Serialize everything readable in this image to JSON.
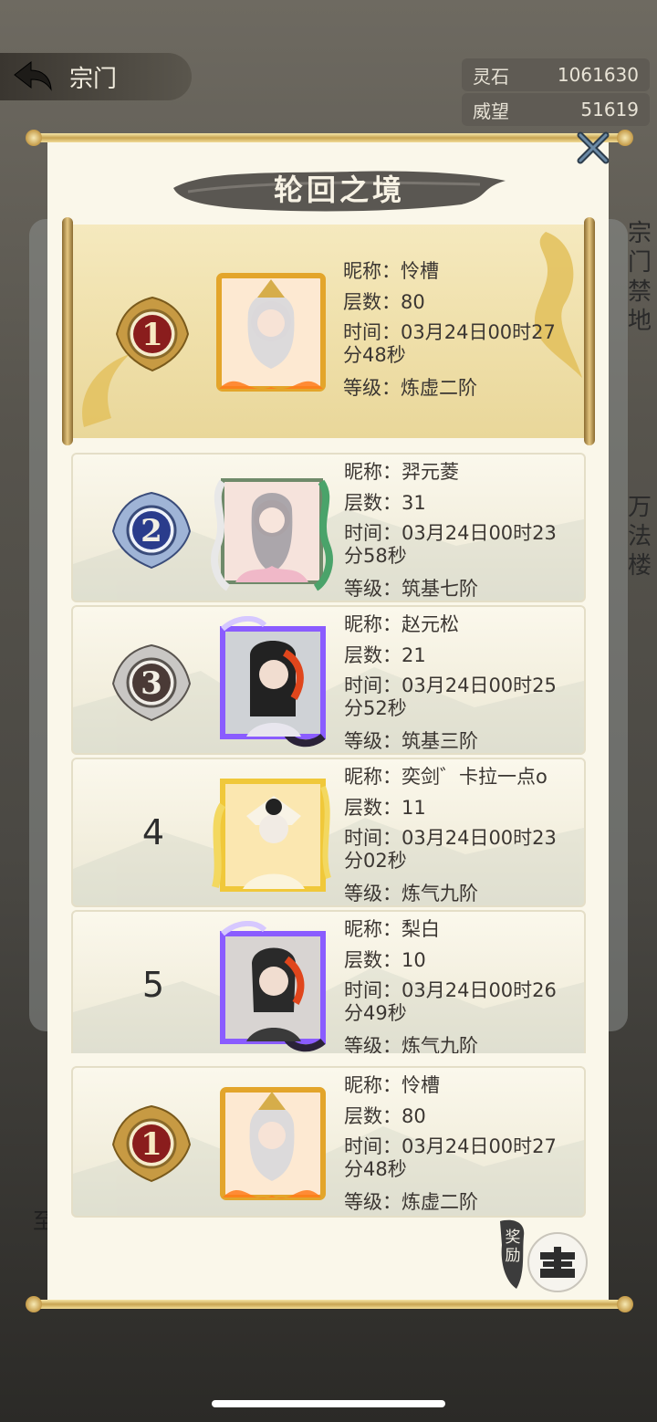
{
  "header": {
    "back_label": "宗门",
    "resources": [
      {
        "name": "灵石",
        "value": "1061630"
      },
      {
        "name": "威望",
        "value": "51619"
      }
    ]
  },
  "background": {
    "side_labels": [
      "宗门禁地",
      "万法楼"
    ],
    "left_label": "至"
  },
  "modal": {
    "title": "轮回之境",
    "labels": {
      "nickname": "昵称：",
      "floors": "层数：",
      "time": "时间：",
      "level": "等级："
    },
    "top_entry": {
      "rank": "1",
      "nickname": "怜槽",
      "floors": "80",
      "time": "03月24日00时27分48秒",
      "level": "炼虚二阶"
    },
    "entries": [
      {
        "rank": "2",
        "nickname": "羿元菱",
        "floors": "31",
        "time": "03月24日00时23分58秒",
        "level": "筑基七阶",
        "frame": "serpent-frame"
      },
      {
        "rank": "3",
        "nickname": "赵元松",
        "floors": "21",
        "time": "03月24日00时25分52秒",
        "level": "筑基三阶",
        "frame": "purple-flame-frame"
      },
      {
        "rank": "4",
        "nickname": "奕剑゛卡拉一点o",
        "floors": "11",
        "time": "03月24日00时23分02秒",
        "level": "炼气九阶",
        "frame": "gold-dragon-frame"
      },
      {
        "rank": "5",
        "nickname": "梨白",
        "floors": "10",
        "time": "03月24日00时26分49秒",
        "level": "炼气九阶",
        "frame": "purple-flame-frame"
      }
    ],
    "self_entry": {
      "rank": "1",
      "nickname": "怜槽",
      "floors": "80",
      "time": "03月24日00时27分48秒",
      "level": "炼虚二阶"
    },
    "reward_label": "奖励"
  },
  "colors": {
    "gold": "#c8a452",
    "rank1_medal": "#8a1d1d",
    "rank2_medal": "#2a3c8c",
    "rank3_medal": "#4a3a36",
    "purple_frame": "#8a5cff"
  }
}
